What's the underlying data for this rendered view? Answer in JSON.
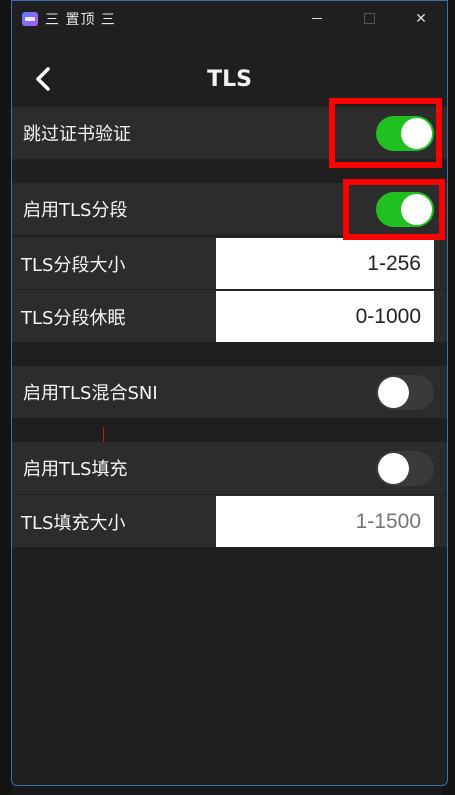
{
  "window": {
    "title": "三 置顶 三",
    "controls": {
      "minimize": "–",
      "maximize": "□",
      "close": "✕"
    }
  },
  "header": {
    "title": "TLS",
    "back_icon": "chevron-left-icon"
  },
  "settings": {
    "skip_cert": {
      "label": "跳过证书验证",
      "enabled": true
    },
    "tls_fragment": {
      "label": "启用TLS分段",
      "enabled": true
    },
    "fragment_size": {
      "label": "TLS分段大小",
      "value": "1-256"
    },
    "fragment_sleep": {
      "label": "TLS分段休眠",
      "value": "0-1000"
    },
    "mixed_sni": {
      "label": "启用TLS混合SNI",
      "enabled": false
    },
    "tls_padding": {
      "label": "启用TLS填充",
      "enabled": false
    },
    "padding_size": {
      "label": "TLS填充大小",
      "placeholder": "1-1500"
    }
  },
  "colors": {
    "toggle_on": "#1fc01f",
    "toggle_off": "#3a3a3a",
    "highlight": "#ff0000",
    "window_border": "#3a6fb0"
  }
}
